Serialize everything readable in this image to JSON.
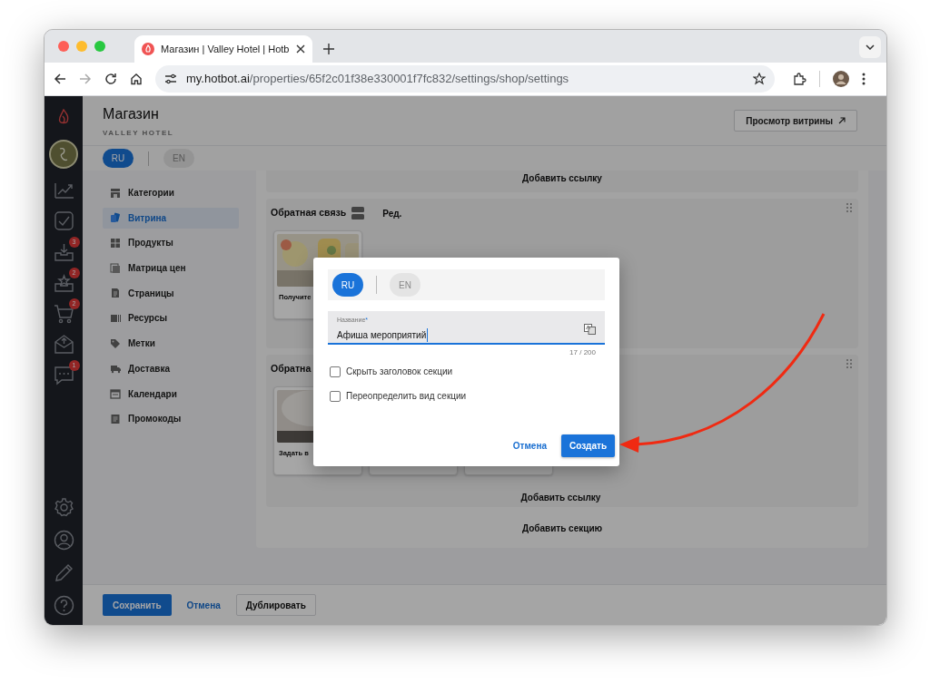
{
  "browser": {
    "tab_title": "Магазин | Valley Hotel | Hotb",
    "url_host": "my.hotbot.ai",
    "url_path": "/properties/65f2c01f38e330001f7fc832/settings/shop/settings"
  },
  "sidebar": {
    "badges": [
      {
        "count": "3"
      },
      {
        "count": "2"
      },
      {
        "count": "2"
      },
      {
        "count": "1"
      }
    ]
  },
  "header": {
    "title": "Магазин",
    "subtitle": "VALLEY HOTEL",
    "preview_button": "Просмотр витрины"
  },
  "languages": [
    {
      "label": "RU",
      "selected": true
    },
    {
      "label": "EN",
      "selected": false
    }
  ],
  "nav": [
    {
      "label": "Категории",
      "selected": false
    },
    {
      "label": "Витрина",
      "selected": true
    },
    {
      "label": "Продукты",
      "selected": false
    },
    {
      "label": "Матрица цен",
      "selected": false
    },
    {
      "label": "Страницы",
      "selected": false
    },
    {
      "label": "Ресурсы",
      "selected": false
    },
    {
      "label": "Метки",
      "selected": false
    },
    {
      "label": "Доставка",
      "selected": false
    },
    {
      "label": "Календари",
      "selected": false
    },
    {
      "label": "Промокоды",
      "selected": false
    }
  ],
  "sections": [
    {
      "kind": "tail",
      "link": "Добавить ссылку"
    },
    {
      "kind": "cards",
      "title": "Обратная связь",
      "edit": "Ред.",
      "cards": [
        {
          "kind": "picture",
          "lines": [
            "Получите"
          ]
        }
      ]
    },
    {
      "kind": "cards",
      "title": "Обратна",
      "cards": [
        {
          "kind": "picture",
          "lines": [
            "Задать в"
          ]
        },
        {
          "kind": "plain"
        },
        {
          "kind": "plain"
        }
      ],
      "link": "Добавить ссылку"
    }
  ],
  "add_section": "Добавить секцию",
  "footer": {
    "save": "Сохранить",
    "cancel": "Отмена",
    "duplicate": "Дублировать"
  },
  "modal": {
    "languages": [
      {
        "label": "RU",
        "selected": true
      },
      {
        "label": "EN",
        "selected": false
      }
    ],
    "field": {
      "label": "Название",
      "required_mark": "*",
      "value": "Афиша мероприятий",
      "counter": "17 / 200"
    },
    "checkboxes": [
      {
        "label": "Скрыть заголовок секции",
        "checked": false
      },
      {
        "label": "Переопределить вид секции",
        "checked": false
      }
    ],
    "cancel": "Отмена",
    "create": "Создать"
  }
}
